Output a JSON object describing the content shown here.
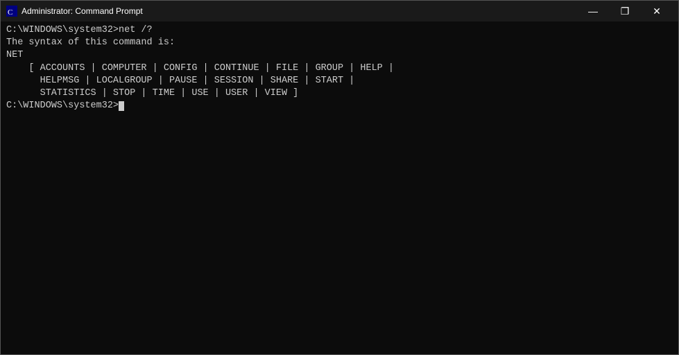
{
  "window": {
    "title": "Administrator: Command Prompt",
    "icon": "cmd-icon"
  },
  "titlebar": {
    "minimize_label": "—",
    "maximize_label": "❐",
    "close_label": "✕"
  },
  "terminal": {
    "lines": [
      {
        "text": "C:\\WINDOWS\\system32>net /?"
      },
      {
        "text": "The syntax of this command is:"
      },
      {
        "text": ""
      },
      {
        "text": "NET"
      },
      {
        "text": "    [ ACCOUNTS | COMPUTER | CONFIG | CONTINUE | FILE | GROUP | HELP |"
      },
      {
        "text": "      HELPMSG | LOCALGROUP | PAUSE | SESSION | SHARE | START |"
      },
      {
        "text": "      STATISTICS | STOP | TIME | USE | USER | VIEW ]"
      },
      {
        "text": ""
      },
      {
        "text": "C:\\WINDOWS\\system32>"
      }
    ]
  }
}
